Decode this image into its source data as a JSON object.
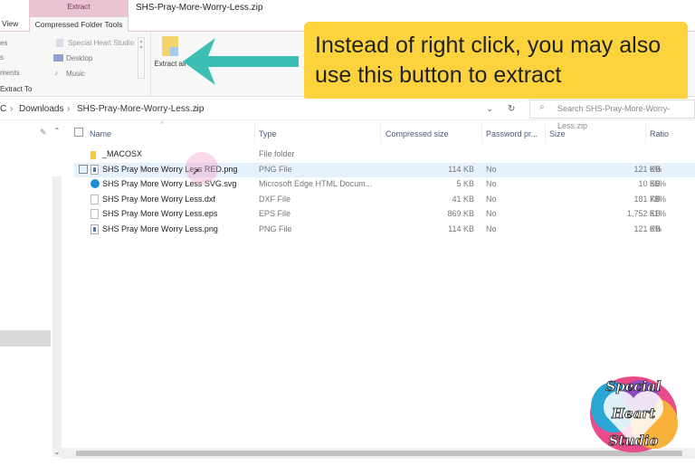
{
  "window": {
    "title": "SHS-Pray-More-Worry-Less.zip",
    "context_tab": "Extract"
  },
  "ribbon": {
    "tabs": [
      "View",
      "Compressed Folder Tools"
    ],
    "destinations": [
      "es",
      "s",
      "ments"
    ],
    "quick": [
      "Special Heart Studio",
      "Desktop",
      "Music"
    ],
    "group_label": "Extract To",
    "extract_all": "Extract all"
  },
  "address": {
    "crumbs": [
      "C",
      "Downloads",
      "SHS-Pray-More-Worry-Less.zip"
    ],
    "search_placeholder": "Search SHS-Pray-More-Worry-Less.zip"
  },
  "columns": [
    "Name",
    "Type",
    "Compressed size",
    "Password pr...",
    "Size",
    "Ratio"
  ],
  "files": [
    {
      "name": "_MACOSX",
      "type": "File folder",
      "compressed": "",
      "password": "",
      "size": "",
      "ratio": "",
      "icon": "folder-icon"
    },
    {
      "name": "SHS Pray More Worry Less RED.png",
      "type": "PNG File",
      "compressed": "114 KB",
      "password": "No",
      "size": "121 KB",
      "ratio": "6%",
      "icon": "image-file-icon"
    },
    {
      "name": "SHS Pray More Worry Less SVG.svg",
      "type": "Microsoft Edge HTML Docum...",
      "compressed": "5 KB",
      "password": "No",
      "size": "10 KB",
      "ratio": "56%",
      "icon": "edge-icon"
    },
    {
      "name": "SHS Pray More Worry Less.dxf",
      "type": "DXF File",
      "compressed": "41 KB",
      "password": "No",
      "size": "181 KB",
      "ratio": "78%",
      "icon": "file-icon"
    },
    {
      "name": "SHS Pray More Worry Less.eps",
      "type": "EPS File",
      "compressed": "869 KB",
      "password": "No",
      "size": "1,752 KB",
      "ratio": "51%",
      "icon": "file-icon"
    },
    {
      "name": "SHS Pray More Worry Less.png",
      "type": "PNG File",
      "compressed": "114 KB",
      "password": "No",
      "size": "121 KB",
      "ratio": "6%",
      "icon": "image-file-icon"
    }
  ],
  "callout": {
    "text": "Instead of right click, you may also use this button to extract",
    "color": "#fdd33d",
    "arrow_color": "#3bbfb4"
  },
  "logo": {
    "text": "Special Heart Studio"
  }
}
